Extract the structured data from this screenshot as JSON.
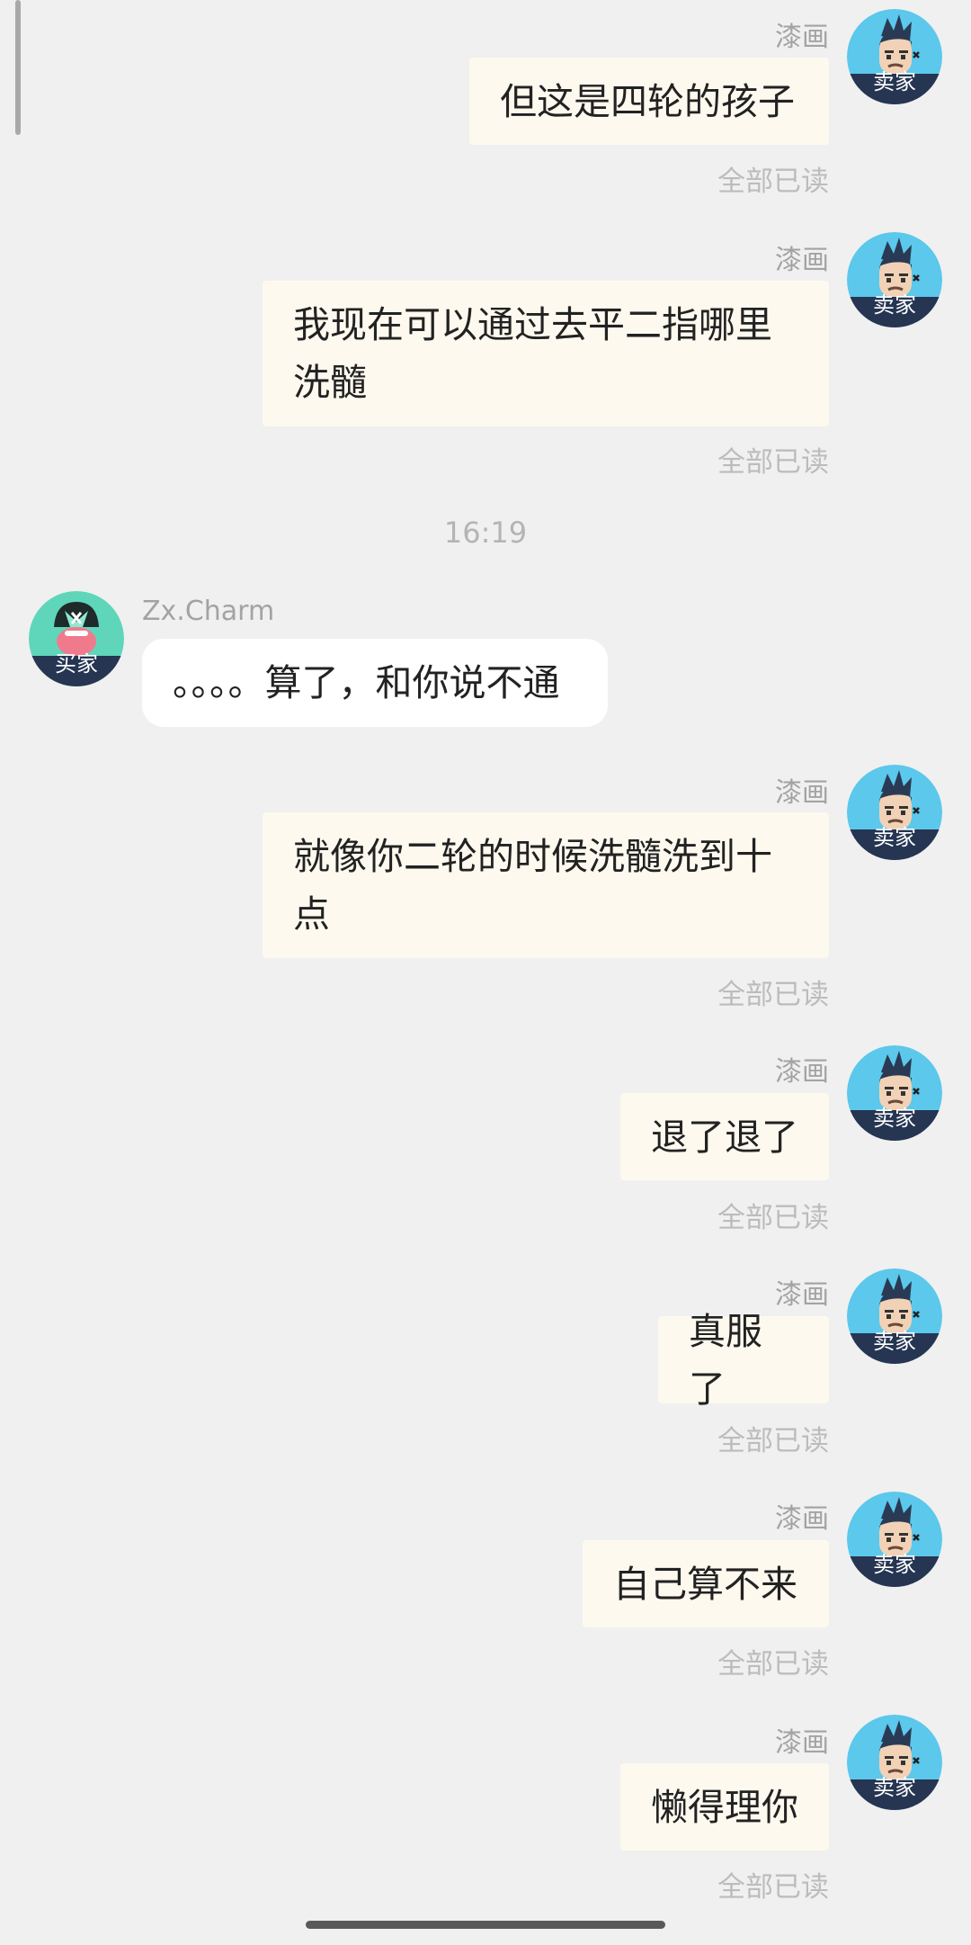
{
  "timestamp": "16:19",
  "seller": {
    "name": "漆画",
    "role": "卖家"
  },
  "buyer": {
    "name": "Zx.Charm",
    "role": "买家"
  },
  "read_status": "全部已读",
  "messages": [
    {
      "text": "但这是四轮的孩子"
    },
    {
      "text": "我现在可以通过去平二指哪里洗髓"
    },
    {
      "text": "。。。。算了，和你说不通"
    },
    {
      "text": "就像你二轮的时候洗髓洗到十点"
    },
    {
      "text": "退了退了"
    },
    {
      "text": "真服了"
    },
    {
      "text": "自己算不来"
    },
    {
      "text": "懒得理你"
    }
  ],
  "colors": {
    "background": "#f0f0f0",
    "outgoing_bubble": "#fdf9ef",
    "incoming_bubble": "#ffffff",
    "seller_avatar_bg": "#5bc8ec",
    "buyer_avatar_bg": "#5fd6b9"
  },
  "icons": [
    "seller-avatar-icon",
    "buyer-avatar-icon"
  ]
}
